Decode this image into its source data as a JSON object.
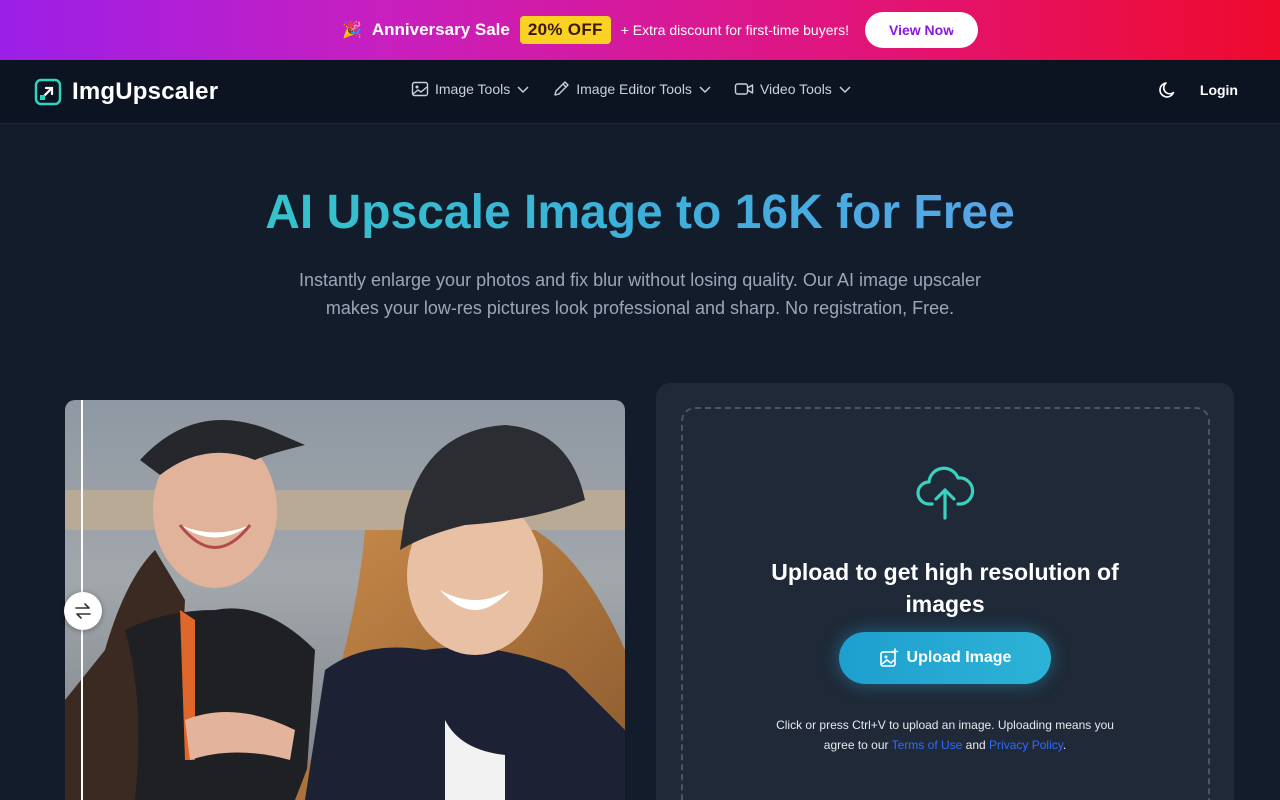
{
  "banner": {
    "emoji": "🎉",
    "title": "Anniversary Sale",
    "badge": "20% OFF",
    "extra": "+ Extra discount for first-time buyers!",
    "cta": "View Now"
  },
  "nav": {
    "logo_text": "ImgUpscaler",
    "menu": [
      {
        "label": "Image Tools",
        "icon": "image-icon"
      },
      {
        "label": "Image Editor Tools",
        "icon": "pencil-icon"
      },
      {
        "label": "Video Tools",
        "icon": "video-icon"
      }
    ],
    "login": "Login"
  },
  "hero": {
    "title": "AI Upscale Image to 16K for Free",
    "subtitle": "Instantly enlarge your photos and fix blur without losing quality. Our AI image upscaler makes your low-res pictures look professional and sharp. No registration, Free."
  },
  "upload": {
    "title": "Upload to get high resolution of images",
    "button": "Upload Image",
    "note_prefix": "Click or press Ctrl+V to upload an image. Uploading means you agree to our",
    "terms": "Terms of Use",
    "and": "and",
    "privacy": "Privacy Policy",
    "period": "."
  },
  "colors": {
    "accent": "#2db3d6",
    "background": "#131c2b",
    "banner_badge": "#fbd224"
  }
}
